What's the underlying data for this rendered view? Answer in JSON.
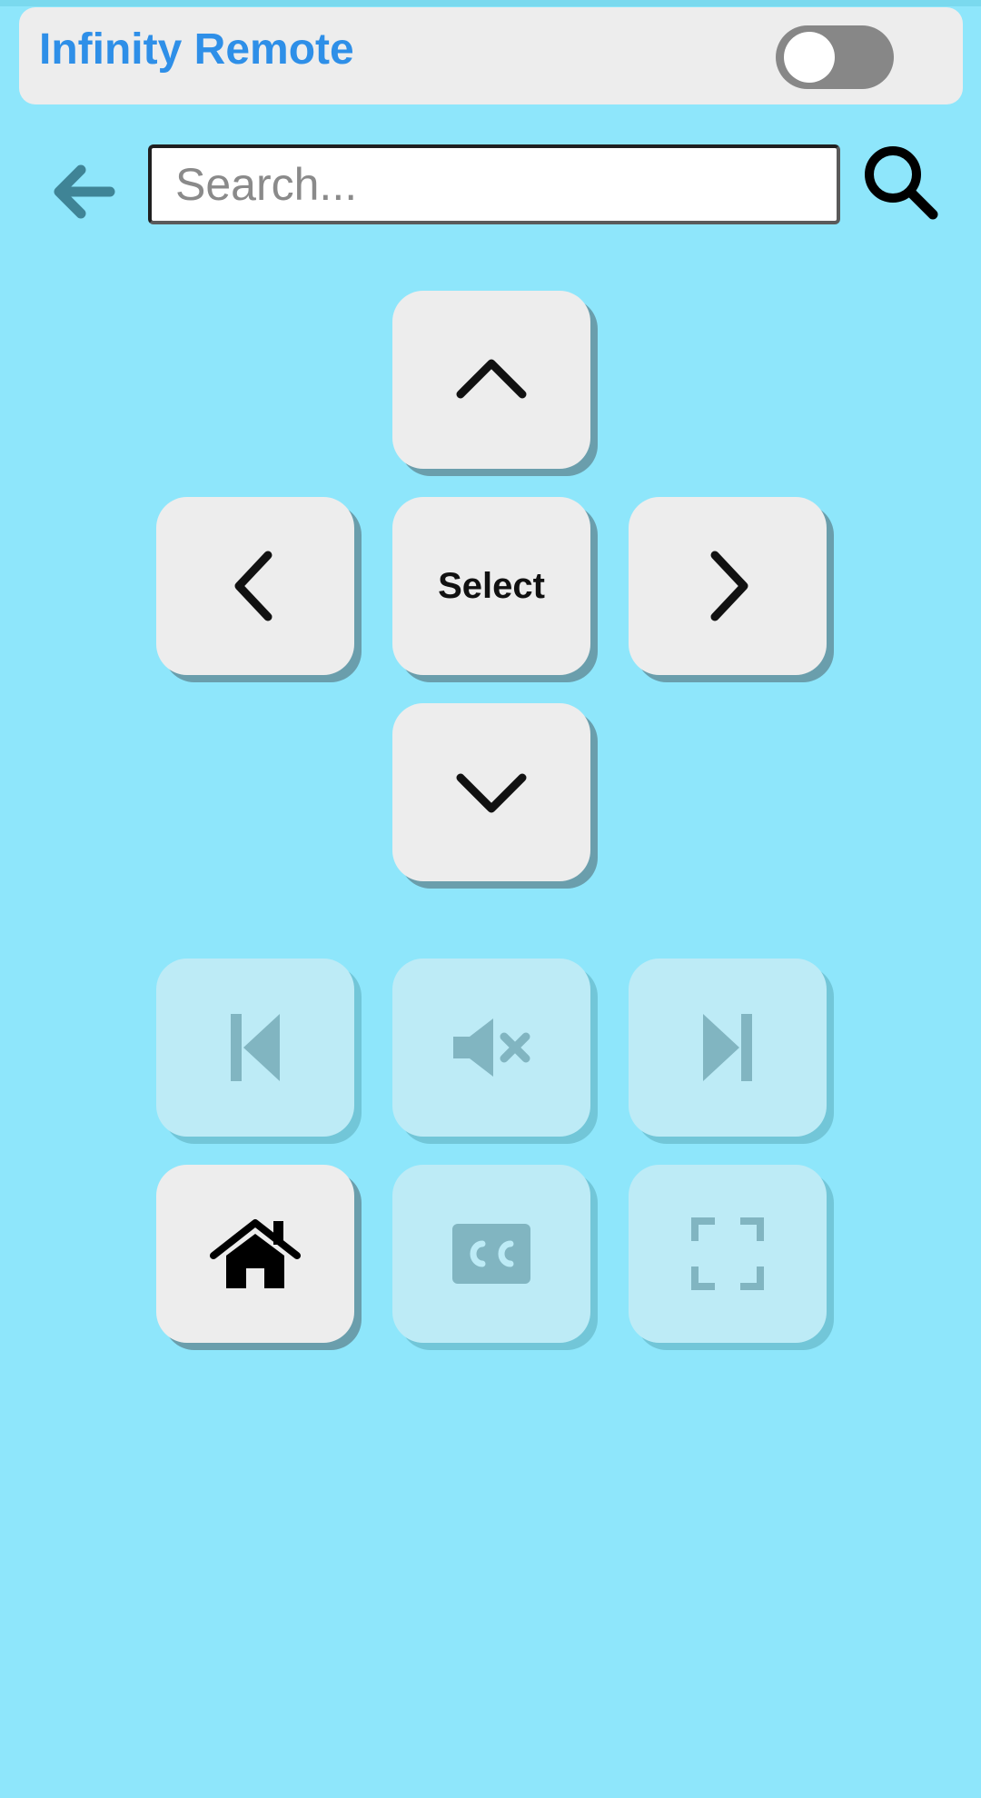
{
  "header": {
    "title": "Infinity Remote",
    "toggle_state": "off"
  },
  "search": {
    "placeholder": "Search...",
    "value": ""
  },
  "dpad": {
    "up_icon": "chevron-up-icon",
    "left_icon": "chevron-left-icon",
    "select_label": "Select",
    "right_icon": "chevron-right-icon",
    "down_icon": "chevron-down-icon"
  },
  "controls": [
    {
      "name": "previous",
      "icon": "skip-previous-icon",
      "enabled": false
    },
    {
      "name": "mute",
      "icon": "volume-mute-icon",
      "enabled": false
    },
    {
      "name": "next",
      "icon": "skip-next-icon",
      "enabled": false
    },
    {
      "name": "home",
      "icon": "home-icon",
      "enabled": true
    },
    {
      "name": "closed-captions",
      "icon": "cc-icon",
      "enabled": false
    },
    {
      "name": "fullscreen",
      "icon": "fullscreen-icon",
      "enabled": false
    }
  ],
  "colors": {
    "background": "#8ee6fb",
    "accent": "#2e8fe8",
    "button": "#ededed",
    "button_disabled": "#bdebf6",
    "icon_disabled": "#81b5c1",
    "back_arrow": "#3f8496"
  }
}
